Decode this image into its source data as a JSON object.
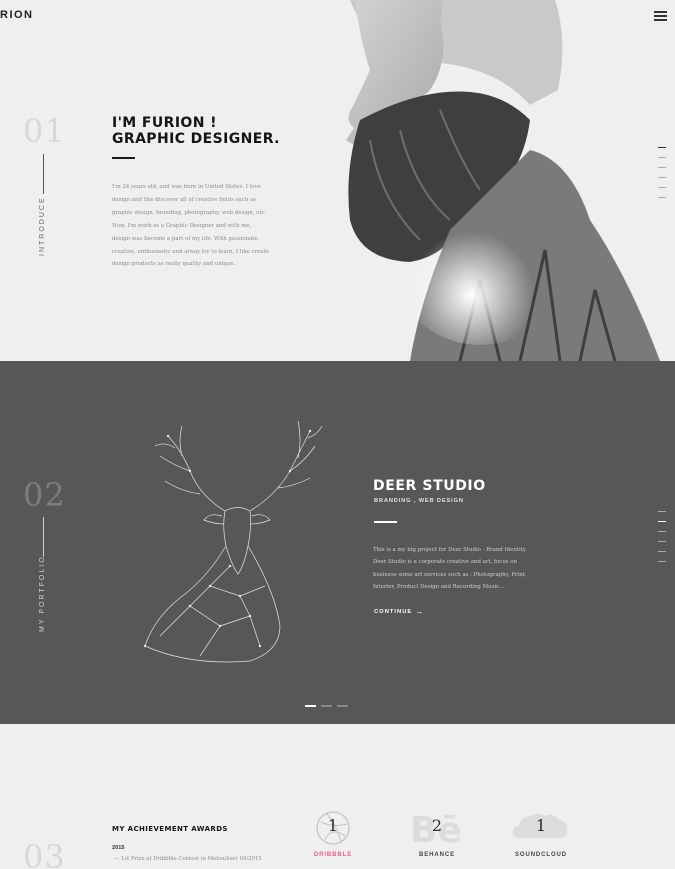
{
  "header": {
    "logo": "RION",
    "menu_icon": "hamburger-icon"
  },
  "intro": {
    "number": "01",
    "label": "INTRODUCE",
    "title_line1": "I'M FURION !",
    "title_line2": "GRAPHIC DESIGNER.",
    "text_lines": [
      "I'm 24 years old, and was born in United States. I love",
      "design and like discover all of creative fields such as :",
      "graphic design, branding, photography, web design, etc.",
      "Now, I'm work as a Graphic Designer and with me,",
      "design was become a part of my life. With passionate,",
      "creative, enthusiastic and alway try to learn, I like create",
      "design products as really quality and unique."
    ]
  },
  "portfolio": {
    "number": "02",
    "label": "MY PORTFOLIO",
    "title": "DEER STUDIO",
    "tags": "BRANDING , WEB DESIGN",
    "text_lines": [
      "This is a my big project for Deer Studio - Brand Identity.",
      "Deer Studio is a corporate creative and art, focus on",
      "business some art services such as : Photography, Print,",
      "Interior, Product Design and Recording Music..."
    ],
    "continue_label": "CONTINUE",
    "slider_active_index": 0
  },
  "achievements": {
    "number": "03",
    "title": "MY ACHIEVEMENT AWARDS",
    "year": "2015",
    "item": "—  1st Prize at Dribbble Contest in Mebouliser 04/2015",
    "awards": [
      {
        "count": "1",
        "name": "DRIBBBLE",
        "icon": "dribbble-icon",
        "color": "#ec5c8e"
      },
      {
        "count": "2",
        "name": "BEHANCE",
        "icon": "behance-icon",
        "color": "#444444"
      },
      {
        "count": "1",
        "name": "SOUNDCLOUD",
        "icon": "soundcloud-icon",
        "color": "#444444"
      }
    ]
  },
  "colors": {
    "dark_section": "#575757",
    "light_section": "#efefef",
    "accent_pink": "#ec5c8e"
  }
}
